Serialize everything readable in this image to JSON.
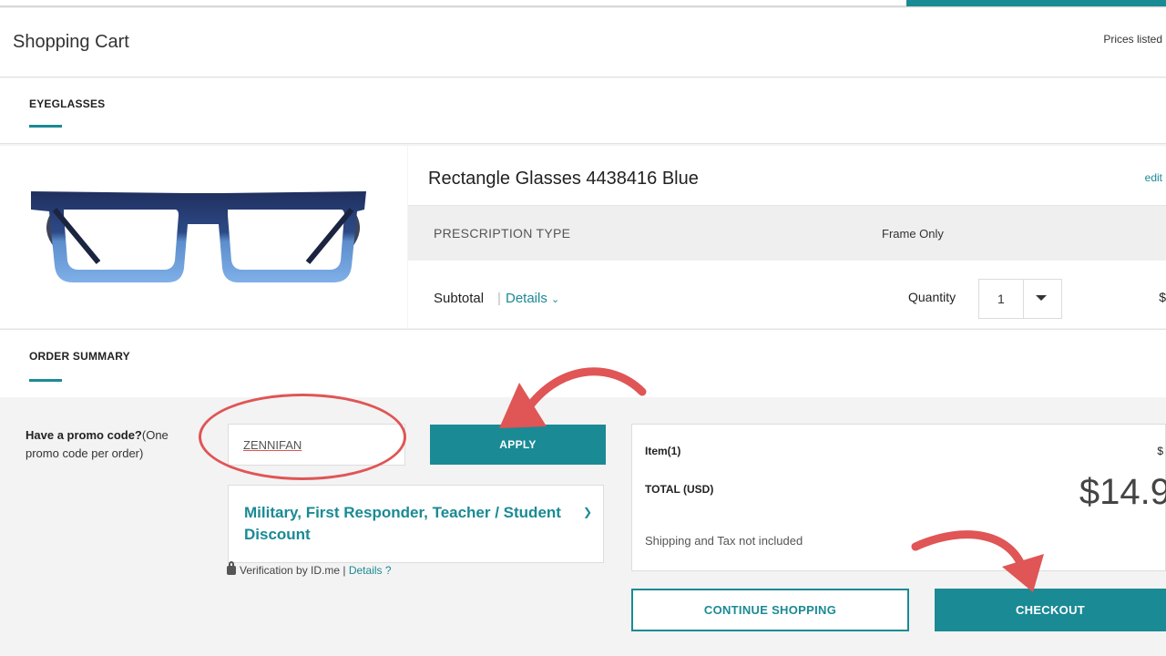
{
  "header": {
    "title": "Shopping Cart",
    "prices_note": "Prices listed"
  },
  "tabs": {
    "eyeglasses": "EYEGLASSES",
    "order_summary": "ORDER SUMMARY"
  },
  "product": {
    "title": "Rectangle Glasses 4438416 Blue",
    "edit_label": "edit",
    "prescription_type_label": "PRESCRIPTION TYPE",
    "prescription_type_value": "Frame Only",
    "subtotal_label": "Subtotal",
    "details_label": "Details",
    "quantity_label": "Quantity",
    "quantity_value": "1",
    "price_edge": "$",
    "frame_colors": {
      "top": "#1f2f5e",
      "bottom": "#6f9fd8"
    }
  },
  "promo": {
    "label_bold": "Have a promo code?",
    "label_rest": "(One promo code per order)",
    "code_value": "ZENNIFAN",
    "apply_label": "APPLY"
  },
  "discount": {
    "title": "Military, First Responder, Teacher / Student Discount",
    "verification_text": "Verification by ID.me |",
    "details_link": "Details ?"
  },
  "totals": {
    "items_label": "Item(1)",
    "items_value": "$",
    "total_label": "TOTAL (USD)",
    "total_value": "$14.9",
    "shipping_note": "Shipping and Tax not included"
  },
  "actions": {
    "continue_label": "CONTINUE SHOPPING",
    "checkout_label": "CHECKOUT"
  },
  "colors": {
    "accent": "#1a8a95",
    "annotation": "#e05555"
  }
}
